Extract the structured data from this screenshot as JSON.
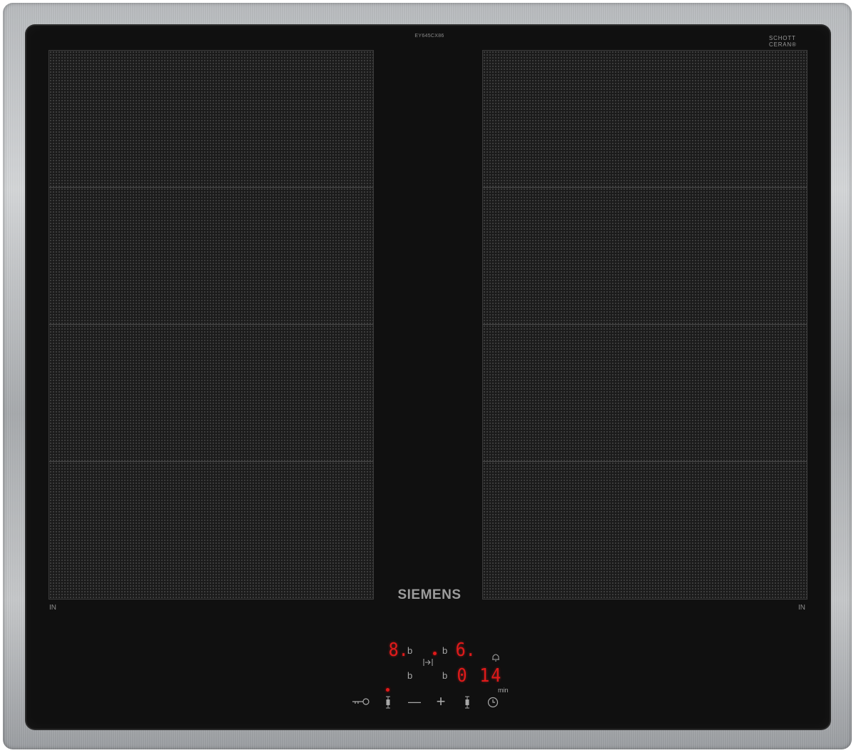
{
  "hob": {
    "model": "EY645CX86",
    "certification": {
      "line1": "SCHOTT",
      "line2": "CERAN®"
    },
    "brand": "SIEMENS",
    "zone_labels": {
      "left": "IN",
      "right": "IN"
    }
  },
  "controls": {
    "left_level": "8.",
    "right_level": "6.",
    "b_mark": "b",
    "timer_value": "0 14",
    "timer_unit": "min",
    "minus": "—",
    "plus": "+"
  },
  "colors": {
    "display_red": "#e01a1a",
    "glass": "#101010",
    "steel": "#b9bcbf"
  }
}
